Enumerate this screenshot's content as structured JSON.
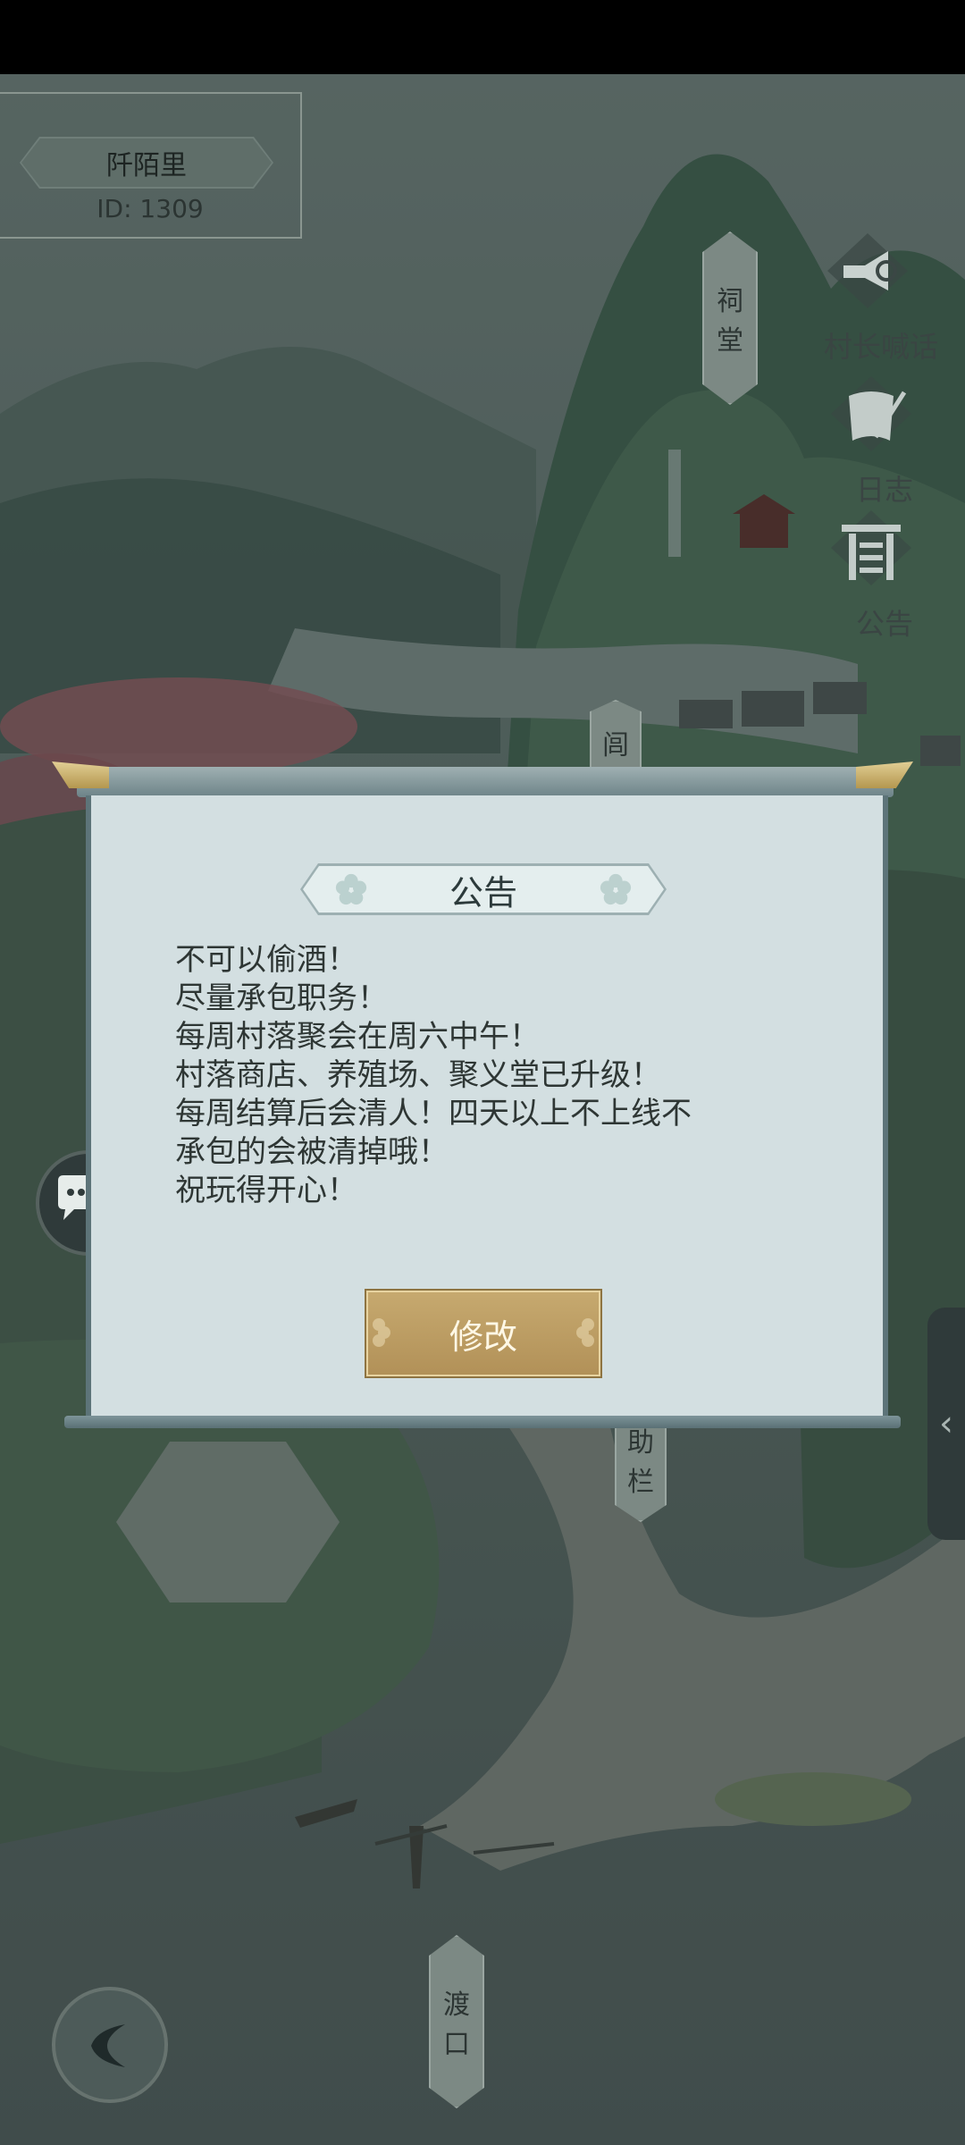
{
  "village": {
    "name": "阡陌里",
    "id_text": "ID: 1309"
  },
  "map_signs": {
    "ancestral_hall": [
      "祠",
      "堂"
    ],
    "lane": "闾",
    "fence": [
      "助",
      "栏"
    ],
    "ferry": [
      "渡",
      "口"
    ]
  },
  "side_menu": [
    {
      "label": "村长喊话",
      "icon": "megaphone-icon"
    },
    {
      "label": "日志",
      "icon": "scroll-quill-icon"
    },
    {
      "label": "公告",
      "icon": "gate-icon"
    }
  ],
  "dialog": {
    "title": "公告",
    "lines": [
      "不可以偷酒！",
      "尽量承包职务！",
      "每周村落聚会在周六中午！",
      "村落商店、养殖场、聚义堂已升级！",
      "每周结算后会清人！四天以上不上线不",
      "承包的会被清掉哦！",
      "祝玩得开心！"
    ],
    "edit_label": "修改"
  },
  "fabs": {
    "chat": "chat-bubbles-icon",
    "back": "back-arrow-icon"
  },
  "colors": {
    "accent_gold": "#b8975a",
    "panel": "#d3dfe1",
    "frame": "#5d7479"
  }
}
